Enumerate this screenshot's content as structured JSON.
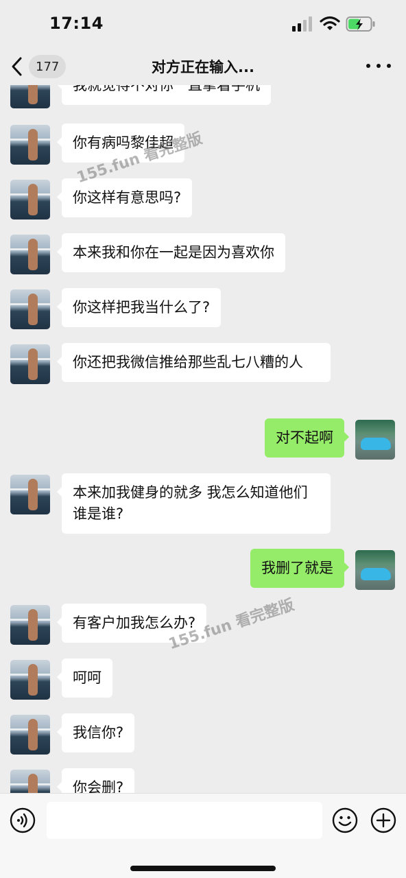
{
  "status_bar": {
    "time": "17:14",
    "icons": [
      "signal-icon",
      "wifi-icon",
      "battery-charging-icon"
    ]
  },
  "header": {
    "unread_count": "177",
    "title": "对方正在输入...",
    "icons": [
      "back-chevron-icon",
      "more-dots-icon"
    ]
  },
  "colors": {
    "background": "#ededed",
    "incoming_bubble": "#ffffff",
    "outgoing_bubble": "#95ec69",
    "battery_accent": "#4cd964"
  },
  "messages": [
    {
      "side": "in",
      "text": "我就觉得不对你一直拿着手机"
    },
    {
      "side": "in",
      "text": "你有病吗黎佳超"
    },
    {
      "side": "in",
      "text": "你这样有意思吗?"
    },
    {
      "side": "in",
      "text": "本来我和你在一起是因为喜欢你"
    },
    {
      "side": "in",
      "text": "你这样把我当什么了?"
    },
    {
      "side": "in",
      "text": "你还把我微信推给那些乱七八糟的人"
    },
    {
      "side": "out",
      "text": "对不起啊"
    },
    {
      "side": "in",
      "text": "本来加我健身的就多 我怎么知道他们谁是谁?"
    },
    {
      "side": "out",
      "text": "我删了就是"
    },
    {
      "side": "in",
      "text": "有客户加我怎么办?"
    },
    {
      "side": "in",
      "text": "呵呵"
    },
    {
      "side": "in",
      "text": "我信你?"
    },
    {
      "side": "in",
      "text": "你会删?"
    }
  ],
  "watermarks": [
    "155.fun 看完整版",
    "155.fun 看完整版"
  ],
  "input_bar": {
    "placeholder": "",
    "icons": [
      "voice-icon",
      "emoji-icon",
      "plus-icon"
    ]
  }
}
